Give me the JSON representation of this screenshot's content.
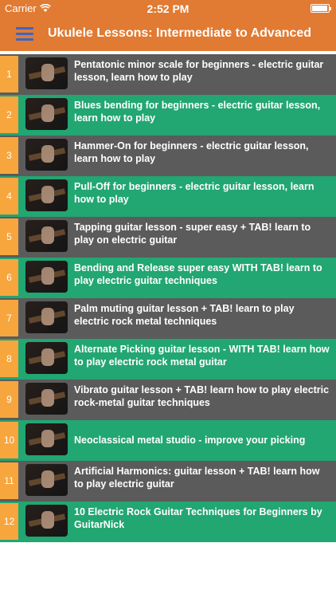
{
  "status": {
    "carrier": "Carrier",
    "wifi_icon": "wifi-icon",
    "time": "2:52 PM",
    "battery_icon": "battery-icon"
  },
  "nav": {
    "menu_icon": "hamburger-menu-icon",
    "title": "Ukulele Lessons: Intermediate to Advanced"
  },
  "colors": {
    "accent": "#e17a32",
    "row_gray": "#5b5b5b",
    "row_green": "#22a672",
    "number_badge": "#f7a63d",
    "menu_icon": "#3a66c4"
  },
  "lessons": [
    {
      "num": "1",
      "title": "Pentatonic minor scale for beginners - electric guitar lesson, learn how to play"
    },
    {
      "num": "2",
      "title": "Blues bending for beginners - electric guitar lesson, learn how to play"
    },
    {
      "num": "3",
      "title": "Hammer-On for beginners - electric guitar lesson, learn how to play"
    },
    {
      "num": "4",
      "title": "Pull-Off for beginners - electric guitar lesson, learn how to play"
    },
    {
      "num": "5",
      "title": "Tapping guitar lesson - super easy + TAB! learn to play on electric guitar"
    },
    {
      "num": "6",
      "title": "Bending and Release super easy WITH TAB! learn to play electric guitar techniques"
    },
    {
      "num": "7",
      "title": "Palm muting guitar lesson + TAB! learn to play electric rock metal techniques"
    },
    {
      "num": "8",
      "title": "Alternate Picking guitar lesson - WITH TAB! learn how to play electric rock metal guitar"
    },
    {
      "num": "9",
      "title": "Vibrato guitar lesson + TAB! learn how to play electric rock-metal guitar techniques"
    },
    {
      "num": "10",
      "title": "Neoclassical metal studio - improve your picking"
    },
    {
      "num": "11",
      "title": "Artificial Harmonics: guitar lesson + TAB! learn how to play electric guitar"
    },
    {
      "num": "12",
      "title": "10 Electric Rock Guitar Techniques for Beginners by GuitarNick"
    }
  ]
}
